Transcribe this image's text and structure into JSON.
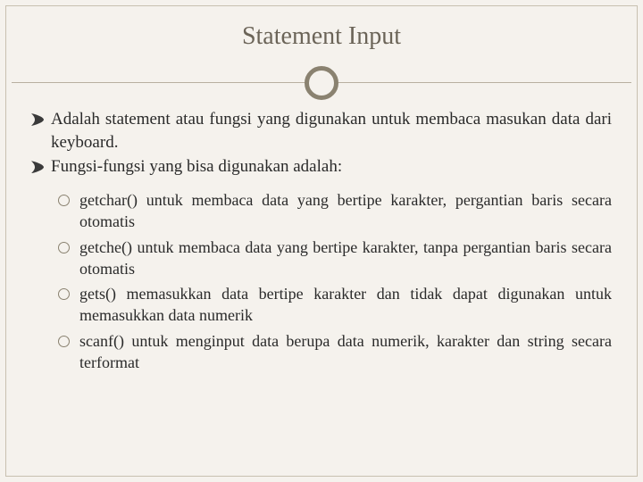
{
  "slide": {
    "title": "Statement Input",
    "main_items": [
      "Adalah statement atau fungsi yang digunakan untuk membaca masukan data dari keyboard.",
      "Fungsi-fungsi yang bisa digunakan adalah:"
    ],
    "sub_items": [
      "getchar() untuk membaca data yang bertipe karakter, pergantian baris secara otomatis",
      "getche() untuk membaca data yang bertipe karakter, tanpa pergantian baris secara otomatis",
      "gets() memasukkan data bertipe karakter dan tidak dapat  digunakan untuk memasukkan data numerik",
      "scanf() untuk menginput data berupa data numerik, karakter dan string secara terformat"
    ]
  }
}
